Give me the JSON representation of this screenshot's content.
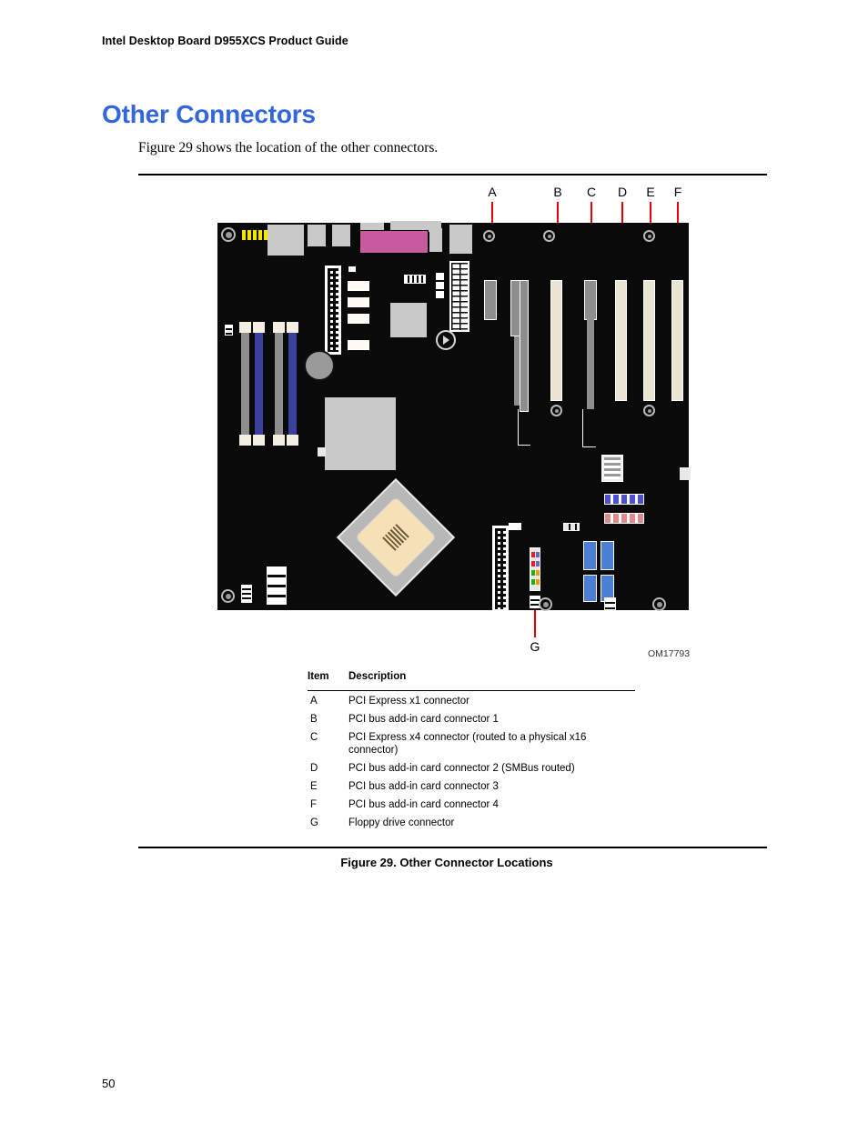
{
  "document": {
    "running_head": "Intel Desktop Board D955XCS Product Guide",
    "page_number": "50"
  },
  "section": {
    "title": "Other Connectors",
    "intro": "Figure 29 shows the location of the other connectors."
  },
  "figure": {
    "caption": "Figure 29.  Other Connector Locations",
    "image_code": "OM17793",
    "callouts": [
      {
        "letter": "A"
      },
      {
        "letter": "B"
      },
      {
        "letter": "C"
      },
      {
        "letter": "D"
      },
      {
        "letter": "E"
      },
      {
        "letter": "F"
      },
      {
        "letter": "G"
      }
    ]
  },
  "table": {
    "headers": {
      "item": "Item",
      "description": "Description"
    },
    "rows": [
      {
        "item": "A",
        "description": "PCI Express x1 connector"
      },
      {
        "item": "B",
        "description": "PCI bus add-in card connector 1"
      },
      {
        "item": "C",
        "description": "PCI Express x4 connector (routed to a physical x16 connector)"
      },
      {
        "item": "D",
        "description": "PCI bus add-in card connector 2 (SMBus routed)"
      },
      {
        "item": "E",
        "description": "PCI bus add-in card connector 3"
      },
      {
        "item": "F",
        "description": "PCI bus add-in card connector 4"
      },
      {
        "item": "G",
        "description": "Floppy drive connector"
      }
    ]
  },
  "colors": {
    "heading": "#3366dd",
    "leader_line": "#ee0000",
    "board": "#0a0a0a",
    "audio_connector": "#c85aa0",
    "dimm_blue": "#3b3f9e",
    "dimm_gray": "#8e8e8e",
    "usb_header": "#4a7fd4",
    "yellow_header": "#f2e500",
    "pcie_slot": "#8e8e8e",
    "pci_slot": "#eae4d4"
  }
}
